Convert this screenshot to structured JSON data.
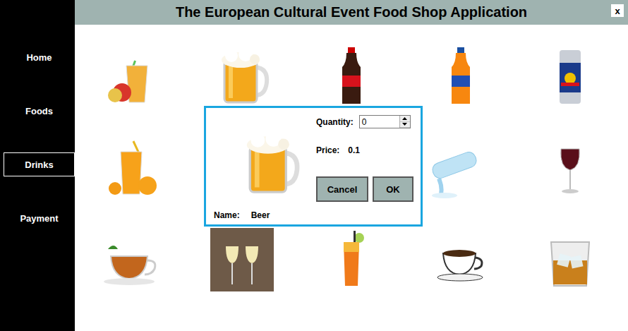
{
  "window": {
    "title": "The European Cultural Event Food Shop Application",
    "close": "x"
  },
  "sidebar": {
    "items": [
      {
        "label": "Home",
        "selected": false
      },
      {
        "label": "Foods",
        "selected": false
      },
      {
        "label": "Drinks",
        "selected": true
      },
      {
        "label": "Payment",
        "selected": false
      }
    ]
  },
  "dialog": {
    "quantity_label": "Quantity:",
    "quantity": "0",
    "price_label": "Price:",
    "price": "0.1",
    "name_label": "Name:",
    "name": "Beer",
    "buttons": [
      "Cancel",
      "OK"
    ]
  }
}
